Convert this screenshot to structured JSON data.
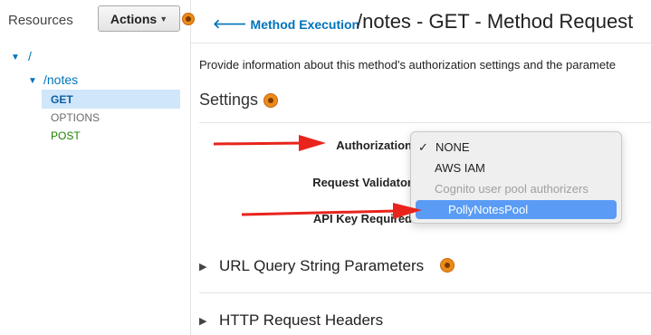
{
  "sidebar": {
    "resources_label": "Resources",
    "actions_label": "Actions",
    "tree": {
      "root": "/",
      "notes": "/notes",
      "methods": [
        "GET",
        "OPTIONS",
        "POST"
      ]
    }
  },
  "header": {
    "back_link": "Method Execution",
    "title": "/notes - GET - Method Request"
  },
  "main": {
    "description": "Provide information about this method's authorization settings and the paramete",
    "settings_heading": "Settings",
    "fields": {
      "authorization": "Authorization",
      "request_validator": "Request Validator",
      "api_key_required": "API Key Required"
    },
    "authorization_menu": {
      "check_mark": "✓",
      "options": [
        "NONE",
        "AWS IAM",
        "Cognito user pool authorizers",
        "PollyNotesPool"
      ],
      "selected": "NONE",
      "highlighted": "PollyNotesPool"
    },
    "sections": {
      "url_query": "URL Query String Parameters",
      "http_headers": "HTTP Request Headers"
    }
  },
  "colors": {
    "link_blue": "#0073bb",
    "info_orange": "#ec8b1a",
    "highlight_blue": "#5a9cf5",
    "arrow_red": "#e8241c",
    "post_green": "#1d8102"
  }
}
